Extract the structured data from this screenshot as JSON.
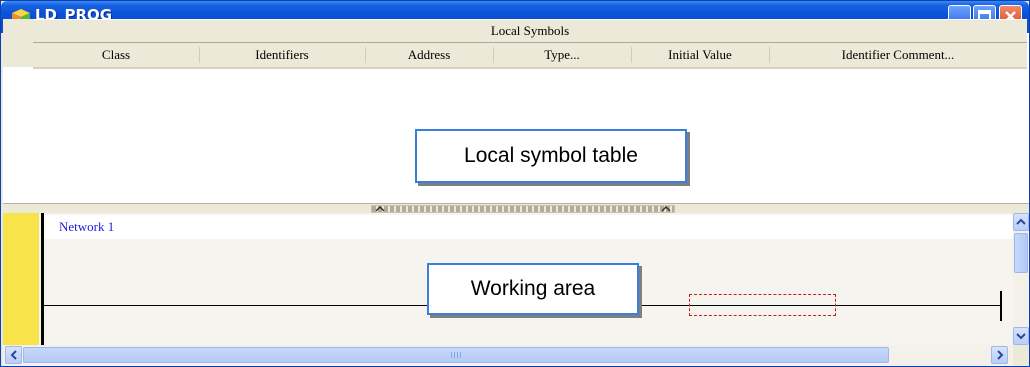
{
  "window": {
    "title": "LD_PROG"
  },
  "symbol_table": {
    "section_title": "Local Symbols",
    "columns": [
      "Class",
      "Identifiers",
      "Address",
      "Type...",
      "Initial Value",
      "Identifier Comment..."
    ]
  },
  "annotations": {
    "symbol_table_label": "Local symbol table",
    "working_area_label": "Working area"
  },
  "editor": {
    "network_label": "Network 1"
  },
  "colors": {
    "title_bar": "#0a52d6",
    "power_rail": "#f8e34a",
    "network_label": "#1b1ed8",
    "placeholder_border": "#c02020",
    "callout_border": "#3a7fe0"
  },
  "icons": [
    "app-cube-icon",
    "minimize-icon",
    "maximize-icon",
    "close-icon",
    "splitter-up-icon",
    "scroll-up-icon",
    "scroll-down-icon",
    "scroll-left-icon",
    "scroll-right-icon"
  ]
}
